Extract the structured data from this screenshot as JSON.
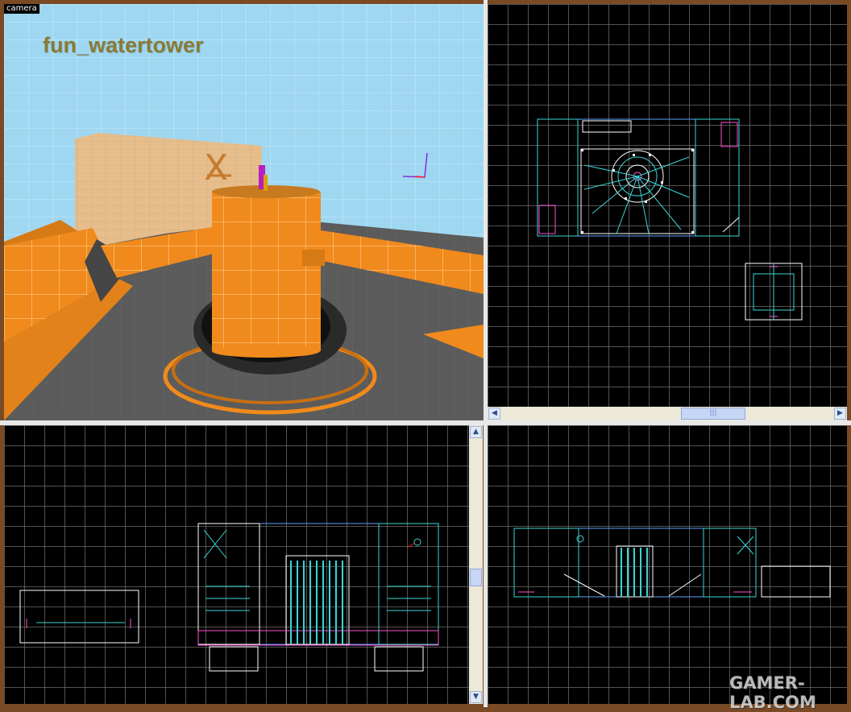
{
  "camera_view": {
    "label": "camera",
    "map_name": "fun_watertower",
    "colors": {
      "sky": "#9fd7f1",
      "floor": "#5e5e5e",
      "wall_orange": "#f08a1c",
      "wall_tan": "#e8c08e"
    }
  },
  "top_view": {
    "grid_color": "#6e6e6e"
  },
  "front_view": {},
  "side_view": {},
  "scrollbars": {
    "h_left_icon": "arrow-left-icon",
    "h_right_icon": "arrow-right-icon",
    "h_grip": "|||",
    "v_up_icon": "arrow-up-icon",
    "v_down_icon": "arrow-down-icon"
  },
  "watermark": "GAMER-LAB.COM"
}
